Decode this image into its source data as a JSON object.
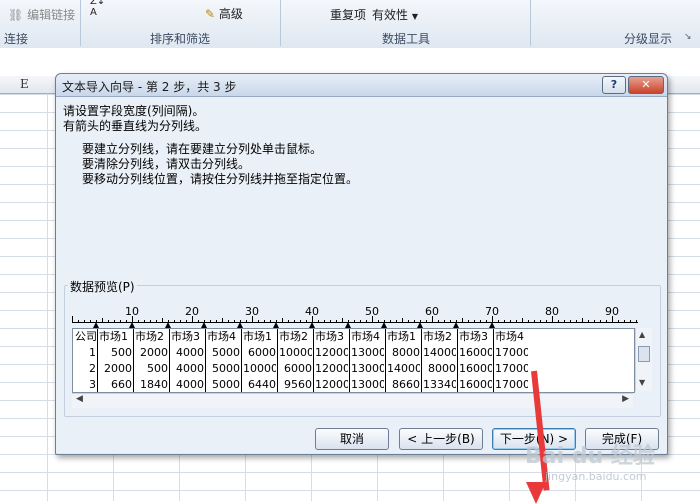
{
  "ribbon": {
    "edit_links": "编辑链接",
    "connections_label": "连接",
    "advanced": "高级",
    "sort_filter_label": "排序和筛选",
    "remove_duplicates": "重复项",
    "data_validation": "有效性",
    "data_tools_label": "数据工具",
    "outline_label": "分级显示"
  },
  "sheet": {
    "column_e": "E"
  },
  "dialog": {
    "title": "文本导入向导 - 第 2 步，共 3 步",
    "help": "?",
    "close": "✕",
    "instr1": "请设置字段宽度(列间隔)。",
    "instr2": "有箭头的垂直线为分列线。",
    "bullet1": "要建立分列线，请在要建立分列处单击鼠标。",
    "bullet2": "要清除分列线，请双击分列线。",
    "bullet3": "要移动分列线位置，请按住分列线并拖至指定位置。",
    "preview_label": "数据预览(P)",
    "ruler_marks": [
      "10",
      "20",
      "30",
      "40",
      "50",
      "60",
      "70",
      "80",
      "90"
    ],
    "preview_rows": [
      [
        "公司",
        "市场1",
        "市场2",
        "市场3",
        "市场4",
        "市场1",
        "市场2",
        "市场3",
        "市场4",
        "市场1",
        "市场2",
        "市场3",
        "市场4"
      ],
      [
        "1",
        "500",
        "2000",
        "4000",
        "5000",
        "6000",
        "10000",
        "12000",
        "13000",
        "8000",
        "14000",
        "16000",
        "17000"
      ],
      [
        "2",
        "2000",
        "500",
        "4000",
        "5000",
        "10000",
        "6000",
        "12000",
        "13000",
        "14000",
        "8000",
        "16000",
        "17000"
      ],
      [
        "3",
        "660",
        "1840",
        "4000",
        "5000",
        "6440",
        "9560",
        "12000",
        "13000",
        "8660",
        "13340",
        "16000",
        "17000"
      ]
    ],
    "cancel": "取消",
    "back": "< 上一步(B)",
    "next": "下一步(N) >",
    "finish": "完成(F)"
  },
  "watermark": {
    "text": "Bai du 经验",
    "sub": "jingyan.baidu.com"
  }
}
